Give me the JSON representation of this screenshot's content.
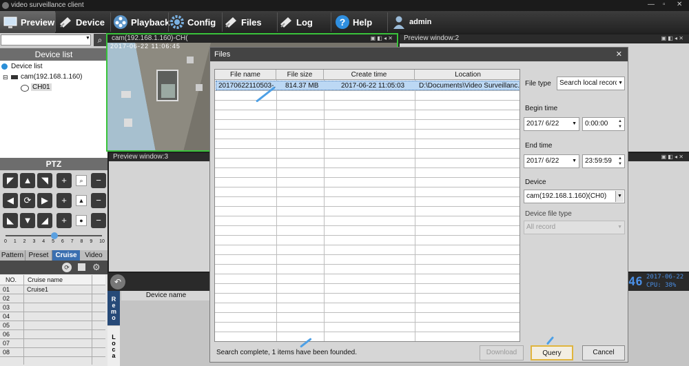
{
  "window": {
    "title": "video surveillance client"
  },
  "toolbar": {
    "items": [
      {
        "label": "Preview"
      },
      {
        "label": "Device"
      },
      {
        "label": "Playback"
      },
      {
        "label": "Config"
      },
      {
        "label": "Files"
      },
      {
        "label": "Log"
      },
      {
        "label": "Help"
      }
    ],
    "user": "admin"
  },
  "sidebar": {
    "device_list_title": "Device list",
    "tree": {
      "root": "Device list",
      "camera": "cam(192.168.1.160)",
      "channel": "CH01"
    },
    "ptz_title": "PTZ",
    "speed_ticks": [
      "0",
      "1",
      "2",
      "3",
      "4",
      "5",
      "6",
      "7",
      "8",
      "9",
      "10"
    ],
    "tabs": [
      "Pattern",
      "Preset",
      "Cruise",
      "Video"
    ],
    "cruise_table": {
      "headers": [
        "NO.",
        "Cruise name"
      ],
      "rows": [
        {
          "no": "01",
          "name": "Cruise1"
        },
        {
          "no": "02",
          "name": ""
        },
        {
          "no": "03",
          "name": ""
        },
        {
          "no": "04",
          "name": ""
        },
        {
          "no": "05",
          "name": ""
        },
        {
          "no": "06",
          "name": ""
        },
        {
          "no": "07",
          "name": ""
        },
        {
          "no": "08",
          "name": ""
        }
      ]
    }
  },
  "preview": {
    "window1_title": "cam(192.168.1.160)-CH(",
    "window1_timestamp": "2017-06-22 11:06:45",
    "window2_title": "Preview window:2",
    "window3_title": "Preview window:3",
    "osd_clock": "46",
    "osd_date": "2017-06-22",
    "osd_cpu": "CPU: 38%",
    "remote_tabs": [
      "Remo",
      "Loca"
    ],
    "device_name_header": "Device name"
  },
  "files_dialog": {
    "title": "Files",
    "columns": [
      "File name",
      "File size",
      "Create time",
      "Location"
    ],
    "rows": [
      {
        "file_name": "20170622110503-...",
        "file_size": "814.37 MB",
        "create_time": "2017-06-22 11:05:03",
        "location": "D:\\Documents\\Video Surveillanc..."
      }
    ],
    "file_type_label": "File type",
    "file_type_value": "Search local record",
    "begin_time_label": "Begin time",
    "begin_date": "2017/ 6/22",
    "begin_clock": "0:00:00",
    "end_time_label": "End time",
    "end_date": "2017/ 6/22",
    "end_clock": "23:59:59",
    "device_label": "Device",
    "device_value": "cam(192.168.1.160)(CH0)",
    "device_file_type_label": "Device file type",
    "device_file_type_value": "All record",
    "status": "Search complete, 1 items have been founded.",
    "download_label": "Download",
    "query_label": "Query",
    "cancel_label": "Cancel"
  },
  "colors": {
    "accent_green": "#39c33a",
    "selection": "#bcd8f4",
    "annotation_arrow": "#4da0e6"
  }
}
